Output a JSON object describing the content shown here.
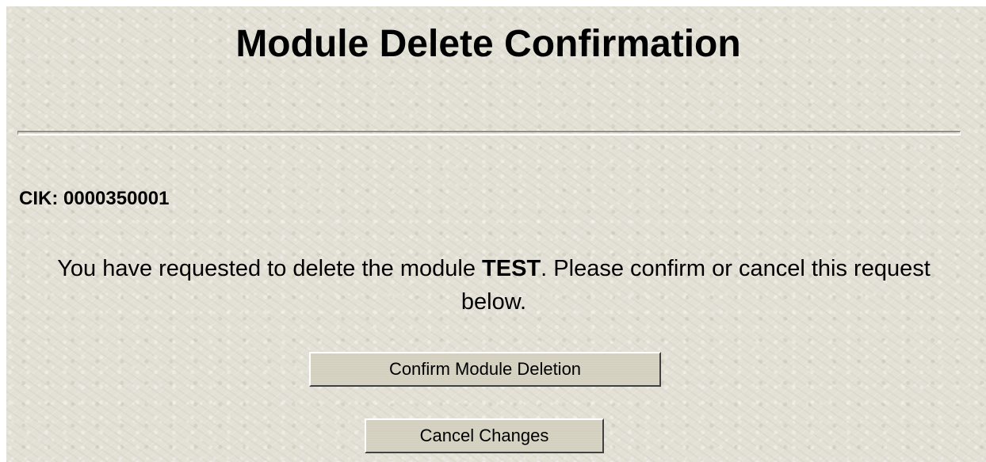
{
  "page": {
    "title": "Module Delete Confirmation"
  },
  "cik": {
    "label": "CIK:",
    "value": "0000350001"
  },
  "message": {
    "before": "You have requested to delete the module ",
    "module_name": "TEST",
    "after": ". Please confirm or cancel this request below."
  },
  "buttons": {
    "confirm_label": "Confirm Module Deletion",
    "cancel_label": "Cancel Changes"
  }
}
